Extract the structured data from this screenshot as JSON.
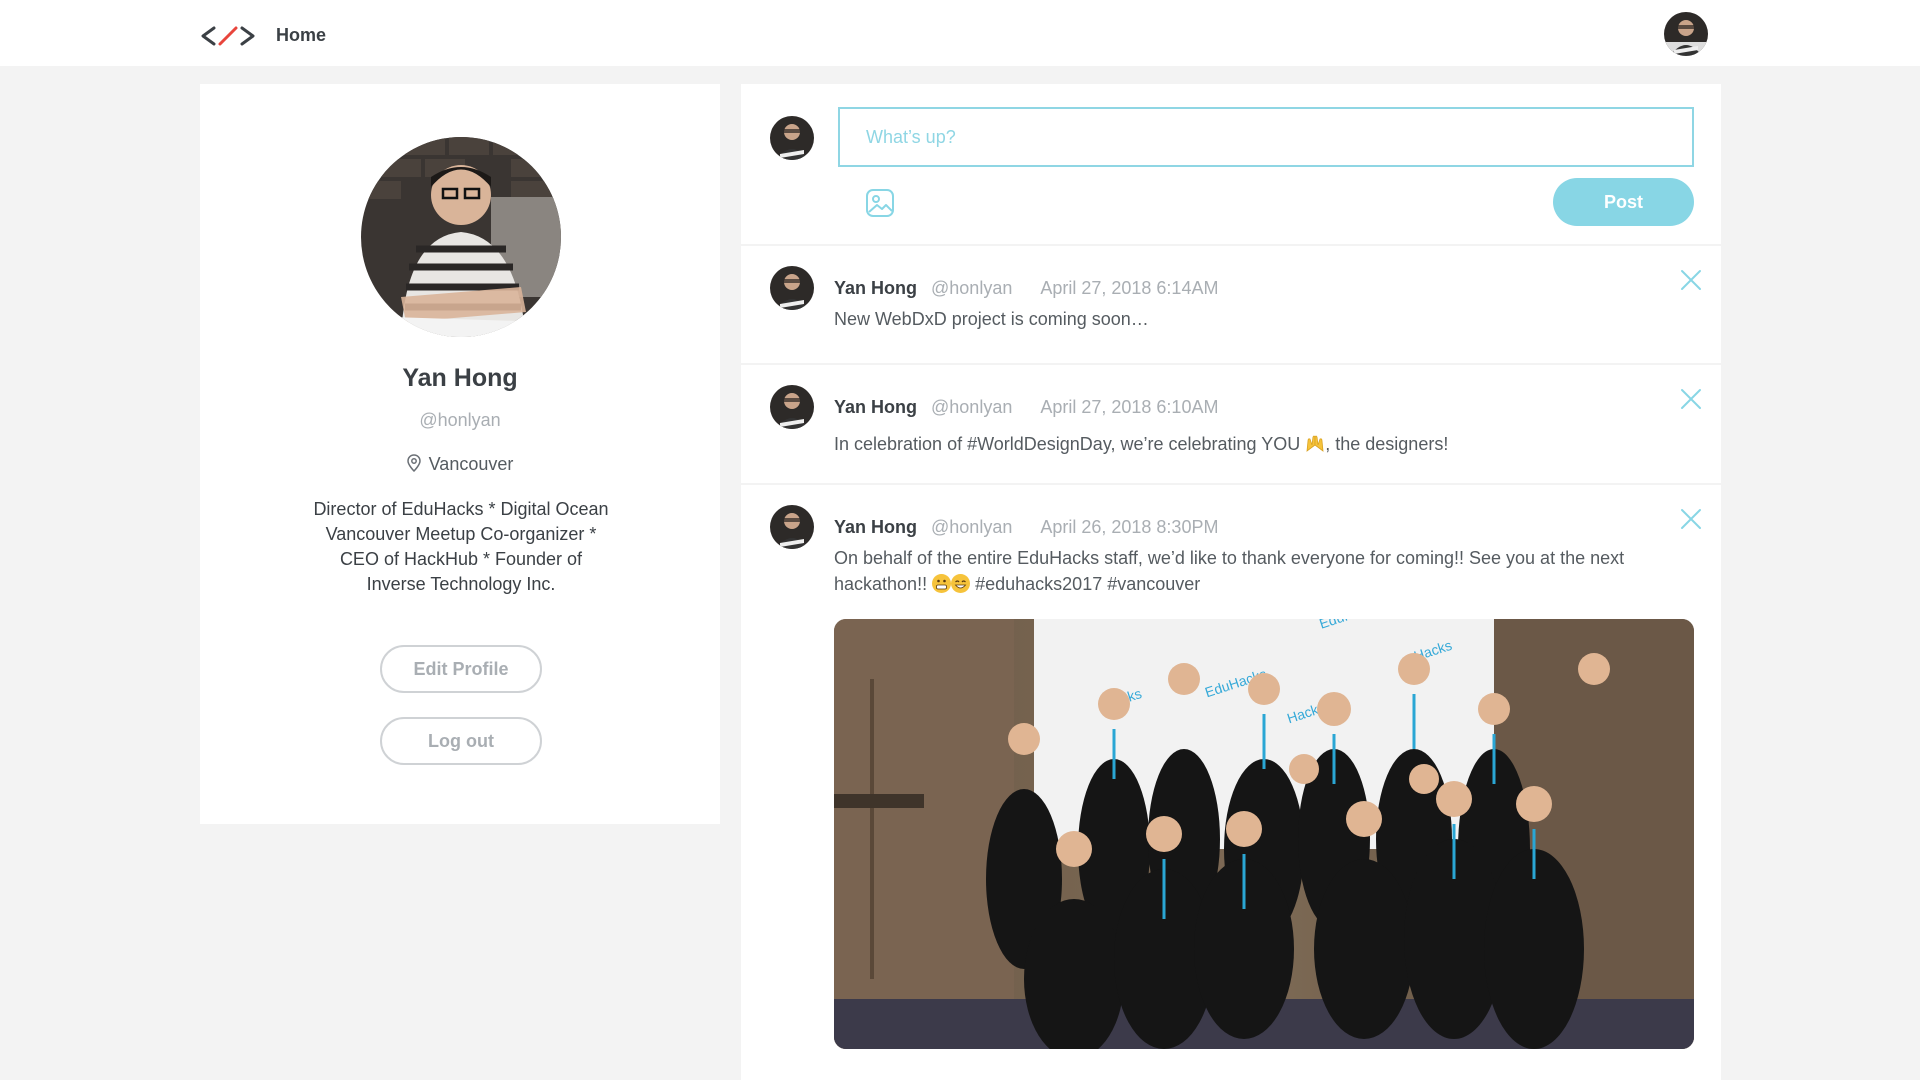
{
  "nav": {
    "home_label": "Home"
  },
  "profile": {
    "name": "Yan Hong",
    "handle": "@honlyan",
    "location": "Vancouver",
    "bio_lines": [
      "Director of EduHacks * Digital Ocean",
      "Vancouver Meetup Co-organizer *",
      "CEO of HackHub * Founder of",
      "Inverse Technology Inc."
    ],
    "edit_label": "Edit Profile",
    "logout_label": "Log out"
  },
  "compose": {
    "placeholder": "What’s up?",
    "post_label": "Post"
  },
  "posts": [
    {
      "author": "Yan Hong",
      "handle": "@honlyan",
      "time": "April 27, 2018 6:14AM",
      "text": "New WebDxD project is coming soon…"
    },
    {
      "author": "Yan Hong",
      "handle": "@honlyan",
      "time": "April 27, 2018 6:10AM",
      "text_before": "In celebration of #WorldDesignDay, we’re celebrating YOU",
      "text_after": ", the designers!"
    },
    {
      "author": "Yan Hong",
      "handle": "@honlyan",
      "time": "April 26, 2018 8:30PM",
      "text_line1": "On behalf of the entire EduHacks staff, we’d like to thank everyone for coming!! See you at the next",
      "text_line2_before": "hackathon!!",
      "text_line2_after": "#eduhacks2017 #vancouver"
    }
  ],
  "photo_text": {
    "banner_words": [
      "EduHacks",
      "Hacks",
      "EduH"
    ]
  },
  "colors": {
    "accent": "#88d6e5",
    "accent_border": "#8fd6e4",
    "logo_red": "#e8453c",
    "text_dark": "#3b4045",
    "text_muted": "#a9aeb3",
    "background": "#f3f3f3"
  },
  "icons": {
    "logo": "code-brackets-logo",
    "location": "location-pin-icon",
    "image_upload": "image-icon",
    "close": "close-icon"
  }
}
